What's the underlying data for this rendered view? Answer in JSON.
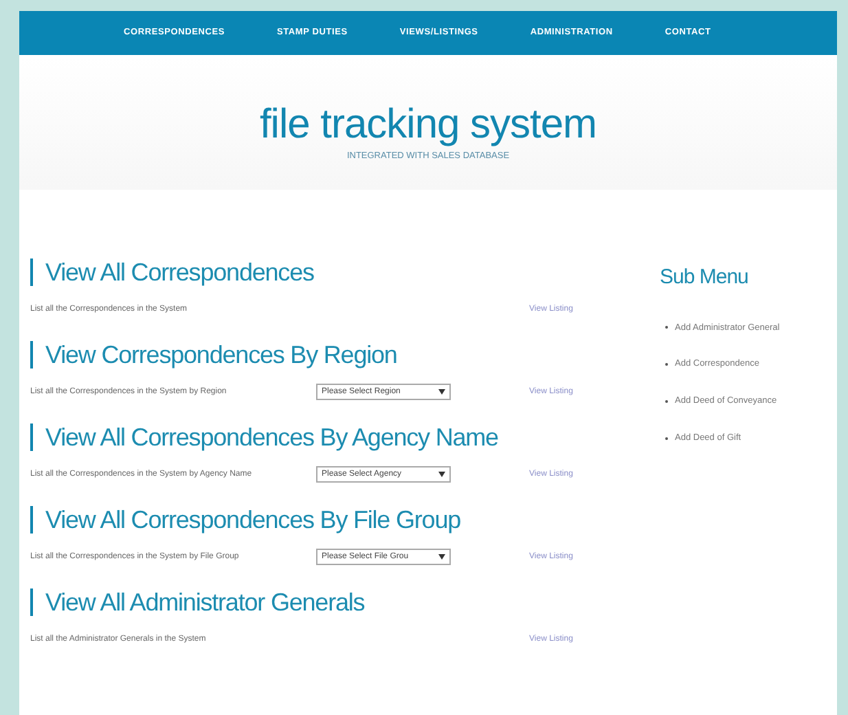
{
  "nav": [
    {
      "label": "CORRESPONDENCES"
    },
    {
      "label": "STAMP DUTIES"
    },
    {
      "label": "VIEWS/LISTINGS"
    },
    {
      "label": "ADMINISTRATION"
    },
    {
      "label": "CONTACT"
    }
  ],
  "header": {
    "title": "file tracking system",
    "subtitle": "INTEGRATED WITH SALES DATABASE"
  },
  "sections": [
    {
      "heading": "View All Correspondences",
      "description": "List all the Correspondences in the System",
      "link": "View Listing"
    },
    {
      "heading": "View Correspondences By Region",
      "description": "List all the Correspondences in the System by Region",
      "select": "Please Select Region",
      "link": "View Listing"
    },
    {
      "heading": "View All Correspondences By Agency Name",
      "description": "List all the Correspondences in the System by Agency Name",
      "select": "Please Select Agency",
      "link": "View Listing"
    },
    {
      "heading": "View All Correspondences By File Group",
      "description": "List all the Correspondences in the System by File Group",
      "select": "Please Select File Grou",
      "link": "View Listing"
    },
    {
      "heading": "View All Administrator Generals",
      "description": "List all the Administrator Generals in the System",
      "link": "View Listing"
    }
  ],
  "sub_menu": {
    "title": "Sub Menu",
    "items": [
      "Add Administrator General",
      "Add Correspondence",
      "Add Deed of Conveyance",
      "Add Deed of Gift"
    ]
  }
}
